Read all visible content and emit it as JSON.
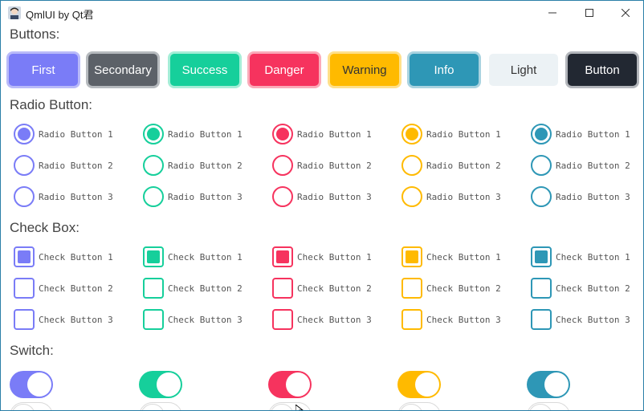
{
  "window": {
    "title": "QmlUI by Qt君",
    "app_icon": "avatar-icon",
    "controls": [
      "minimize-icon",
      "maximize-icon",
      "close-icon"
    ]
  },
  "sections": {
    "buttons": "Buttons:",
    "radio": "Radio Button:",
    "check": "Check Box:",
    "switch": "Switch:"
  },
  "buttons": [
    {
      "label": "First",
      "bg": "#7a7cf7",
      "fg": "#ffffff",
      "glow": "#b9baf9"
    },
    {
      "label": "Secondary",
      "bg": "#5c6168",
      "fg": "#ffffff",
      "glow": "#b6babe"
    },
    {
      "label": "Success",
      "bg": "#16cf9b",
      "fg": "#ffffff",
      "glow": "#a5eed7"
    },
    {
      "label": "Danger",
      "bg": "#f6335e",
      "fg": "#ffffff",
      "glow": "#fbaab9"
    },
    {
      "label": "Warning",
      "bg": "#ffba00",
      "fg": "#333333",
      "glow": "#ffe08a"
    },
    {
      "label": "Info",
      "bg": "#2e97b6",
      "fg": "#ffffff",
      "glow": "#a9d3e0"
    },
    {
      "label": "Light",
      "bg": "#ecf2f5",
      "fg": "#333333",
      "glow": "#ffffff"
    },
    {
      "label": "Button",
      "bg": "#222832",
      "fg": "#ffffff",
      "glow": "#b3b6bb"
    }
  ],
  "palette": [
    "#7a7cf7",
    "#16cf9b",
    "#f6335e",
    "#ffba00",
    "#2e97b6"
  ],
  "radio_labels": [
    "Radio Button 1",
    "Radio Button 2",
    "Radio Button 3"
  ],
  "check_labels": [
    "Check Button 1",
    "Check Button 2",
    "Check Button 3"
  ],
  "radio_selected_index": 0,
  "check_checked_index": 0,
  "switch_states": [
    {
      "on": true
    },
    {
      "on": false
    }
  ]
}
